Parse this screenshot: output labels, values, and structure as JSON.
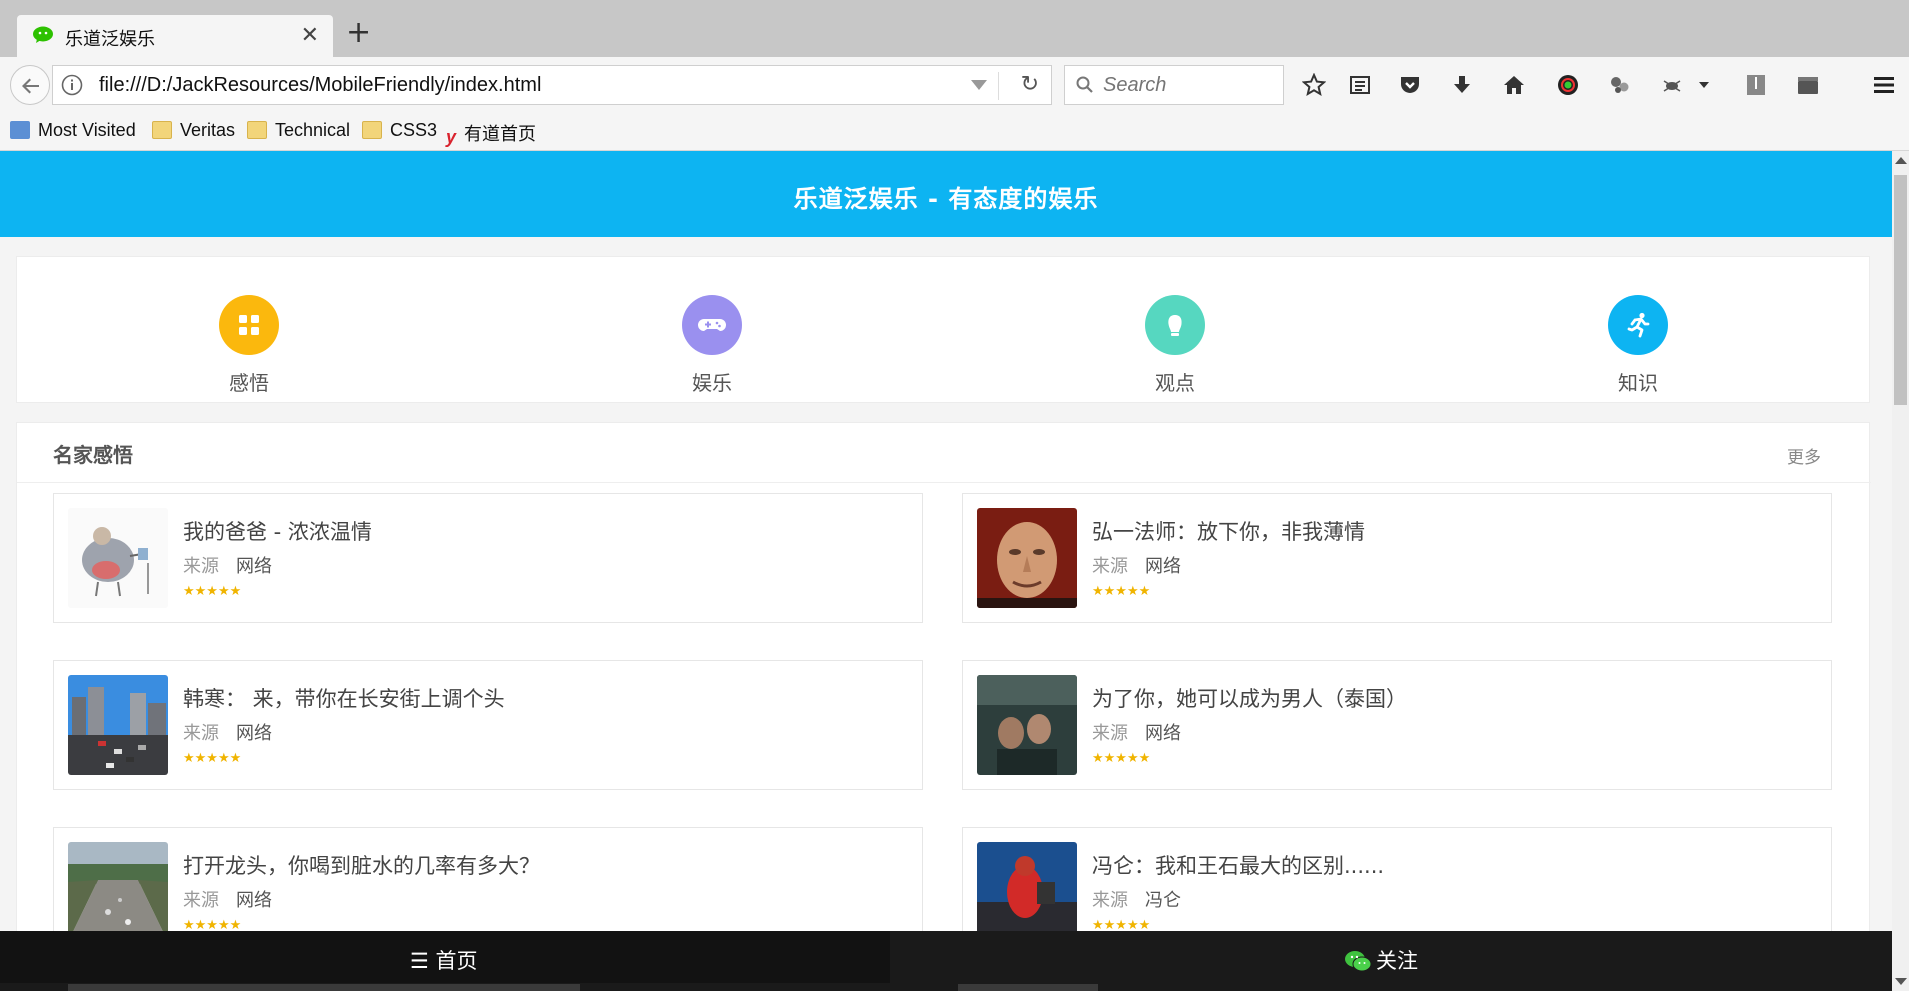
{
  "browser": {
    "tab_title": "乐道泛娱乐",
    "url": "file:///D:/JackResources/MobileFriendly/index.html",
    "search_placeholder": "Search",
    "bookmarks": [
      "Most Visited",
      "Veritas",
      "Technical",
      "CSS3",
      "有道首页"
    ]
  },
  "page": {
    "banner_title": "乐道泛娱乐  -  有态度的娱乐",
    "categories": [
      {
        "label": "感悟",
        "color": "#fbb80d",
        "icon": "grid-icon"
      },
      {
        "label": "娱乐",
        "color": "#9a90ef",
        "icon": "gamepad-icon"
      },
      {
        "label": "观点",
        "color": "#56d7c0",
        "icon": "viewpoint-icon"
      },
      {
        "label": "知识",
        "color": "#0db4f2",
        "icon": "running-icon"
      }
    ],
    "section": {
      "title": "名家感悟",
      "more": "更多",
      "source_label": "来源",
      "stars": "★★★★★",
      "articles": [
        {
          "title": "我的爸爸 - 浓浓温情",
          "source": "网络"
        },
        {
          "title": "弘一法师：放下你，非我薄情",
          "source": "网络"
        },
        {
          "title": "韩寒： 来，带你在长安街上调个头",
          "source": "网络"
        },
        {
          "title": "为了你，她可以成为男人（泰国）",
          "source": "网络"
        },
        {
          "title": "打开龙头，你喝到脏水的几率有多大？",
          "source": "网络"
        },
        {
          "title": "冯仑：我和王石最大的区别......",
          "source": "冯仑"
        }
      ]
    },
    "bottom_nav": {
      "home": "☰ 首页",
      "follow": "关注"
    }
  },
  "colors": {
    "banner": "#0db4f2",
    "star": "#f0b400"
  }
}
